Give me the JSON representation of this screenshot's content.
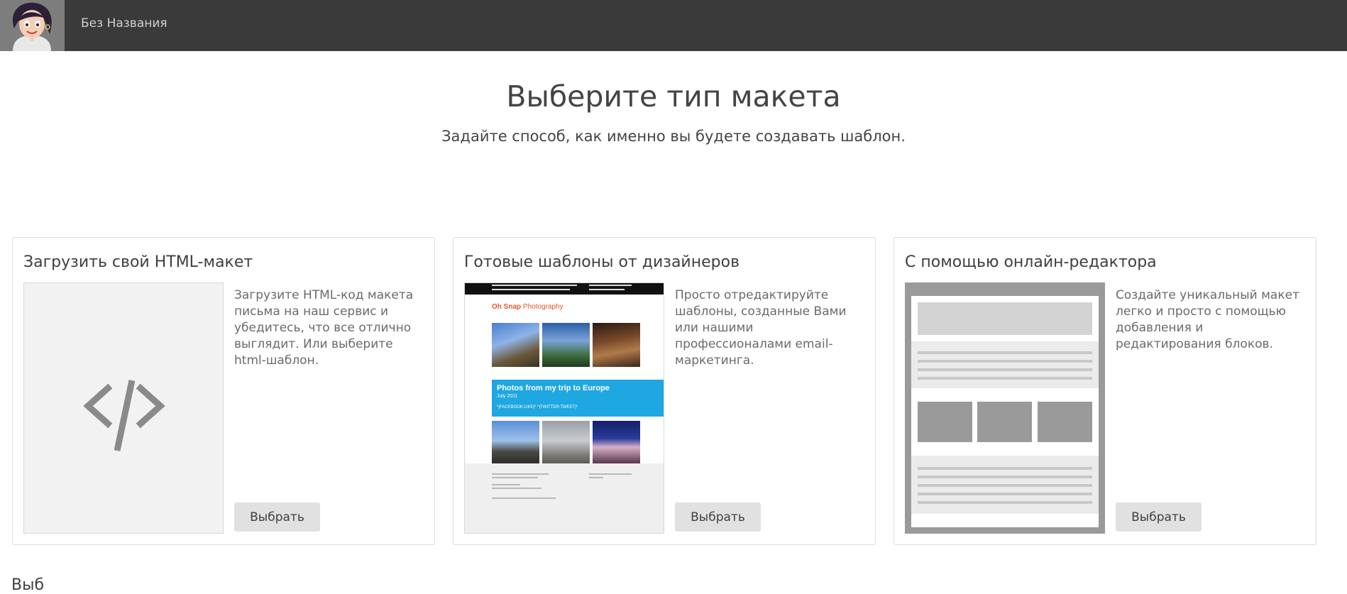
{
  "header": {
    "document_title": "Без Названия"
  },
  "page": {
    "title": "Выберите тип макета",
    "subtitle": "Задайте способ, как именно вы будете создавать шаблон."
  },
  "cards": [
    {
      "title": "Загрузить свой HTML-макет",
      "description": "Загрузите HTML-код макета письма на наш сервис и убедитесь, что все отлично выглядит. Или выберите html-шаблон.",
      "button": "Выбрать",
      "preview_icon": "code-icon"
    },
    {
      "title": "Готовые шаблоны от дизайнеров",
      "description": "Просто отредактируйте шаблоны, созданные Вами или нашими профессионалами email-маркетинга.",
      "button": "Выбрать",
      "preview": {
        "brand_bold": "Oh Snap",
        "brand_rest": " Photography",
        "banner_title": "Photos from my trip to Europe",
        "banner_date": "July 2011",
        "banner_social": "*|FACEBOOK:LIKE|*  *|TWITTER:TWEET|*"
      }
    },
    {
      "title": "С помощью онлайн-редактора",
      "description": "Создайте уникальный макет легко и просто с помощью добавления и редактирования блоков.",
      "button": "Выбрать",
      "preview_icon": "layout-blocks-icon"
    }
  ],
  "bottom_partial_text": "Выб",
  "colors": {
    "topbar": "#3a3a3a",
    "button_bg": "#e1e1e1",
    "banner_blue": "#1ea7e1",
    "brand_orange": "#e8542a"
  }
}
